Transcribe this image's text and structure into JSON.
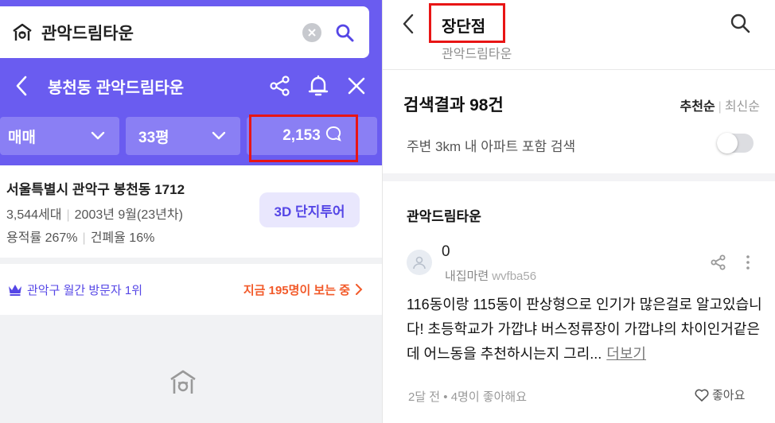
{
  "left": {
    "search": {
      "query": "관악드림타운"
    },
    "nav": {
      "title": "봉천동 관악드림타운"
    },
    "filters": {
      "trade_type": "매매",
      "area": "33평",
      "comment_count": "2,153"
    },
    "info": {
      "address": "서울특별시 관악구 봉천동 1712",
      "households": "3,544세대",
      "built": "2003년 9월(23년차)",
      "floor_area_ratio": "용적률 267%",
      "coverage_ratio": "건폐율 16%",
      "tour_button": "3D 단지투어"
    },
    "rank": {
      "text": "관악구 월간 방문자 1위",
      "viewers": "지금 195명이 보는 중"
    }
  },
  "right": {
    "header": {
      "title": "장단점",
      "subtitle": "관악드림타운"
    },
    "results": {
      "count": "검색결과 98건",
      "sort_active": "추천순",
      "sort_inactive": "최신순",
      "nearby_label": "주변 3km 내 아파트 포함 검색",
      "nearby_enabled": false
    },
    "post": {
      "complex": "관악드림타운",
      "author_name": "0",
      "author_type": "내집마련",
      "author_id": "wvfba56",
      "body": "116동이랑 115동이 판상형으로 인기가 많은걸로 알고있습니다! 초등학교가 가깝냐 버스정류장이 가깝냐의 차이인거같은데 어느동을 추천하시는지 그리...",
      "more_label": "더보기",
      "stats": "2달 전 • 4명이 좋아해요",
      "like_label": "좋아요"
    }
  },
  "colors": {
    "brand_purple": "#6a5cf0",
    "highlight_red": "#e81515",
    "orange": "#f25a2a"
  }
}
